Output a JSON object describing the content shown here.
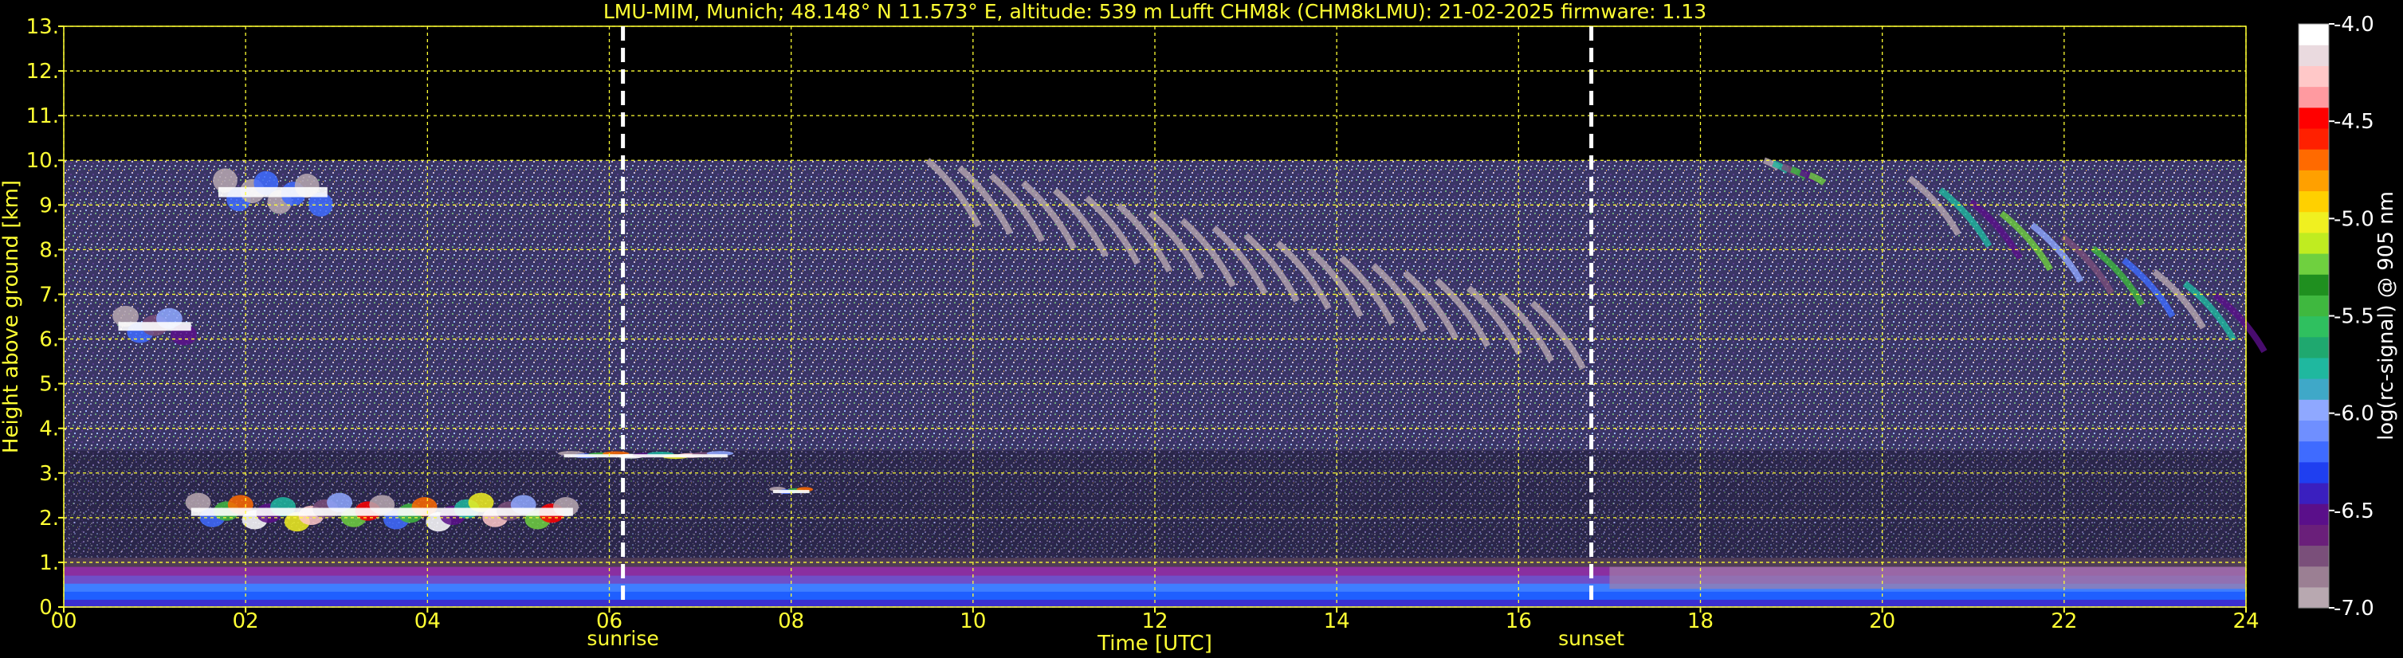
{
  "chart_data": {
    "type": "heatmap",
    "title": "LMU-MIM, Munich; 48.148° N 11.573° E, altitude: 539 m    Lufft CHM8k (CHM8kLMU): 21-02-2025    firmware: 1.13",
    "xlabel": "Time [UTC]",
    "ylabel": "Height above ground [km]",
    "xlim": [
      0,
      24
    ],
    "ylim": [
      0,
      13
    ],
    "x_ticks": [
      {
        "value": 0,
        "label": "00"
      },
      {
        "value": 2,
        "label": "02"
      },
      {
        "value": 4,
        "label": "04"
      },
      {
        "value": 6,
        "label": "06"
      },
      {
        "value": 8,
        "label": "08"
      },
      {
        "value": 10,
        "label": "10"
      },
      {
        "value": 12,
        "label": "12"
      },
      {
        "value": 14,
        "label": "14"
      },
      {
        "value": 16,
        "label": "16"
      },
      {
        "value": 18,
        "label": "18"
      },
      {
        "value": 20,
        "label": "20"
      },
      {
        "value": 22,
        "label": "22"
      },
      {
        "value": 24,
        "label": "24"
      }
    ],
    "y_ticks": [
      {
        "value": 0,
        "label": "0."
      },
      {
        "value": 1,
        "label": "1."
      },
      {
        "value": 2,
        "label": "2."
      },
      {
        "value": 3,
        "label": "3."
      },
      {
        "value": 4,
        "label": "4."
      },
      {
        "value": 5,
        "label": "5."
      },
      {
        "value": 6,
        "label": "6."
      },
      {
        "value": 7,
        "label": "7."
      },
      {
        "value": 8,
        "label": "8."
      },
      {
        "value": 9,
        "label": "9."
      },
      {
        "value": 10,
        "label": "10."
      },
      {
        "value": 11,
        "label": "11."
      },
      {
        "value": 12,
        "label": "12."
      },
      {
        "value": 13,
        "label": "13."
      }
    ],
    "grid": true,
    "max_range_km": 10,
    "markers": [
      {
        "time": 6.15,
        "label": "sunrise"
      },
      {
        "time": 16.8,
        "label": "sunset"
      }
    ],
    "colorbar": {
      "label": "log(rc-signal) @ 905 nm",
      "min": -7.0,
      "max": -4.0,
      "ticks": [
        {
          "value": -4.0,
          "label": "-4.0"
        },
        {
          "value": -4.5,
          "label": "-4.5"
        },
        {
          "value": -5.0,
          "label": "-5.0"
        },
        {
          "value": -5.5,
          "label": "-5.5"
        },
        {
          "value": -6.0,
          "label": "-6.0"
        },
        {
          "value": -6.5,
          "label": "-6.5"
        },
        {
          "value": -7.0,
          "label": "-7.0"
        }
      ],
      "colors": [
        "#b8a8b0",
        "#9b7f93",
        "#7a4f7a",
        "#6a1f7a",
        "#5a0f8a",
        "#3a1fbf",
        "#1f3ff0",
        "#3f6bff",
        "#6f8fff",
        "#8fa8ff",
        "#3fa8c8",
        "#1fb89f",
        "#1fa86f",
        "#2fc05f",
        "#3fb83f",
        "#1f8f1f",
        "#6fd03f",
        "#c0ec20",
        "#f0f020",
        "#ffd000",
        "#ffa000",
        "#ff6a00",
        "#ff2000",
        "#ff0000",
        "#ff9aa0",
        "#ffc8c8",
        "#eadadf",
        "#ffffff"
      ]
    },
    "features": [
      {
        "kind": "boundary_layer",
        "t_start": 0,
        "t_end": 24,
        "h_bottom": 0,
        "h_top": 0.9,
        "log_signal": -6.5
      },
      {
        "kind": "aerosol_layer",
        "t_start": 0,
        "t_end": 24,
        "h_bottom": 0.9,
        "h_top": 1.1,
        "log_signal": -7.0
      },
      {
        "kind": "cloud",
        "t_start": 1.4,
        "t_end": 5.6,
        "h_bottom": 1.5,
        "h_top": 2.7,
        "log_signal": -4.0
      },
      {
        "kind": "cloud",
        "t_start": 5.5,
        "t_end": 7.3,
        "h_bottom": 3.3,
        "h_top": 3.5,
        "log_signal": -4.0
      },
      {
        "kind": "cloud",
        "t_start": 7.8,
        "t_end": 8.2,
        "h_bottom": 2.5,
        "h_top": 2.7,
        "log_signal": -4.0
      },
      {
        "kind": "cloud",
        "t_start": 0.6,
        "t_end": 1.4,
        "h_bottom": 5.6,
        "h_top": 6.9,
        "log_signal": -5.8
      },
      {
        "kind": "cloud",
        "t_start": 1.7,
        "t_end": 2.9,
        "h_bottom": 8.5,
        "h_top": 10.0,
        "log_signal": -5.6
      },
      {
        "kind": "cirrus",
        "t_start": 9.5,
        "t_end": 16.5,
        "h_bottom": 5.8,
        "h_top": 10.0,
        "log_signal": -5.8
      },
      {
        "kind": "cirrus",
        "t_start": 18.7,
        "t_end": 19.3,
        "h_bottom": 9.5,
        "h_top": 10.0,
        "log_signal": -5.0
      },
      {
        "kind": "cirrus",
        "t_start": 20.3,
        "t_end": 24,
        "h_bottom": 6.0,
        "h_top": 9.6,
        "log_signal": -5.2
      }
    ]
  }
}
